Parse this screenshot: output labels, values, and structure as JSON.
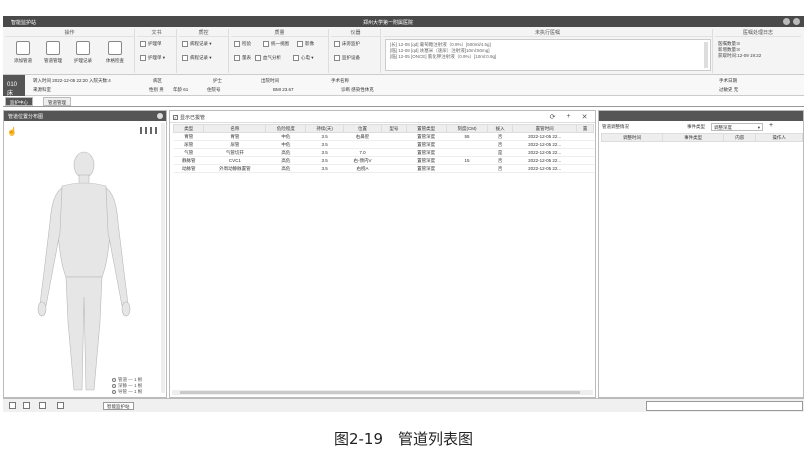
{
  "window": {
    "app_title": "智能监护站",
    "center_title": "郑州大学第一附属医院"
  },
  "ribbon": {
    "groups": {
      "ops": "操作",
      "docs": "文书",
      "vitals": "质控",
      "assess": "质量",
      "devices": "仪器",
      "todo": "未执行医嘱",
      "history": "医嘱处理日志"
    },
    "ops_buttons": [
      "添加管道",
      "管道管理",
      "护理记录",
      "体格检查"
    ],
    "docs_buttons": [
      "护理单",
      "护理单 ▾"
    ],
    "vitals_buttons": [
      "病程记录 ▾",
      "病程记录 ▾"
    ],
    "assess_buttons": [
      "检验",
      "统一视图",
      "影像",
      "量表",
      "血气分析",
      "心电 ▾"
    ],
    "device_buttons": [
      "床旁监护",
      "监护设备"
    ],
    "todo_lines": [
      "[长] 12-08 [qd] 葡萄糖注射液（0.9%）[500ml/4.5g]",
      "[临] 12-08 [qd] 呋塞米（速尿）注射液[10ml:50mg]",
      "[临] 12-05 [ONCE] 氯化钾注射液（0.9%）[10ml:0.9g]"
    ],
    "history_lines": [
      "医嘱数量:8",
      "新增数量:8",
      "获取时间:12-09 19:22"
    ]
  },
  "patient": {
    "bed": "010床",
    "admit": "转入时间 2022-12-05 22:20 入院天数:4",
    "area_label": "病区",
    "nurse_label": "护士",
    "birth_label": "出院时间",
    "surgery_label": "手术名称",
    "source": "来源科室",
    "sex": "性别 男",
    "age": "年龄 61",
    "id_label": "住院号",
    "bmi": "BMI 23.67",
    "diag": "诊断 感染性休克",
    "surgery_date": "手术日期",
    "allergy": "过敏史 无"
  },
  "tabs": [
    "监护中心",
    "管道管理"
  ],
  "left_panel": {
    "title": "管道位置分布图",
    "legend": [
      "管道 — 1 根",
      "深静 — 1 根",
      "导管 — 1 根"
    ]
  },
  "main_panel": {
    "show_removed": "显示已拔管",
    "columns": [
      "类型",
      "名称",
      "危险程度",
      "持续(天)",
      "位置",
      "型号",
      "置管类型",
      "刻度(CM)",
      "拔入",
      "置管时间",
      "置"
    ],
    "rows": [
      [
        "胃管",
        "胃管",
        "中危",
        "3.5",
        "右鼻腔",
        "",
        "置管深度",
        "55",
        "否",
        "2022-12-05 22...",
        ""
      ],
      [
        "尿管",
        "尿管",
        "中危",
        "3.5",
        "",
        "",
        "置管深度",
        "",
        "否",
        "2022-12-05 22...",
        ""
      ],
      [
        "气管",
        "气管切开",
        "高危",
        "3.5",
        "7.0",
        "",
        "置管深度",
        "",
        "是",
        "2022-12-05 22...",
        ""
      ],
      [
        "静脉管",
        "CVC1",
        "高危",
        "3.5",
        "右-颈内V",
        "",
        "置管深度",
        "15",
        "否",
        "2022-12-05 22...",
        ""
      ],
      [
        "动脉管",
        "外周动静脉置管",
        "高危",
        "3.5",
        "右桡A",
        "",
        "置管深度",
        "",
        "否",
        "2022-12-05 22...",
        ""
      ]
    ]
  },
  "right_panel": {
    "filter_label": "管道调整情况",
    "event_type_label": "事件类型",
    "event_type_value": "调整深度",
    "columns": [
      "调整时间",
      "事件类型",
      "内容",
      "操作人"
    ]
  },
  "status": {
    "task": "智能监护站"
  },
  "caption": "图2-19　管道列表图",
  "colors": {
    "dark_header": "#4a4a4a",
    "accent": "#555555"
  }
}
